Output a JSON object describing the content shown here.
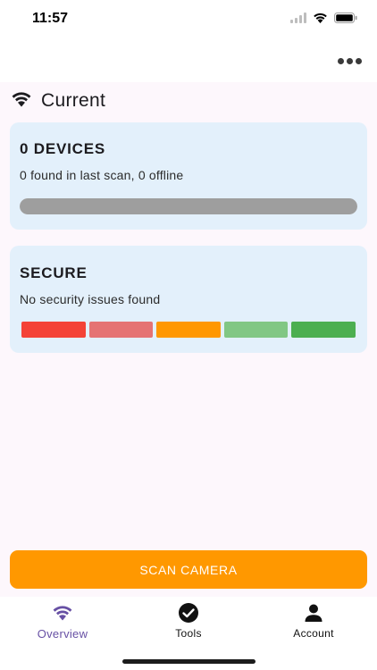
{
  "status_bar": {
    "time": "11:57",
    "icons": [
      "signal-icon",
      "wifi-icon",
      "battery-icon"
    ]
  },
  "app_bar": {
    "more_icon": "more-horizontal-icon"
  },
  "network": {
    "icon": "wifi-icon",
    "name": "Current"
  },
  "devices_card": {
    "title": "0 DEVICES",
    "subtitle": "0 found in last scan, 0 offline",
    "progress": 1.0
  },
  "security_card": {
    "title": "SECURE",
    "subtitle": "No security issues found",
    "scale_colors": [
      "#f44336",
      "#e57373",
      "#ff9800",
      "#81c784",
      "#4caf50"
    ]
  },
  "scan_button": {
    "label": "SCAN CAMERA"
  },
  "bottom_nav": {
    "items": [
      {
        "label": "Overview",
        "icon": "wifi-icon",
        "active": true
      },
      {
        "label": "Tools",
        "icon": "check-circle-icon",
        "active": false
      },
      {
        "label": "Account",
        "icon": "person-icon",
        "active": false
      }
    ]
  },
  "colors": {
    "accent": "#ff9800",
    "nav_active": "#6750a4",
    "card_bg": "#e3f0fb"
  }
}
